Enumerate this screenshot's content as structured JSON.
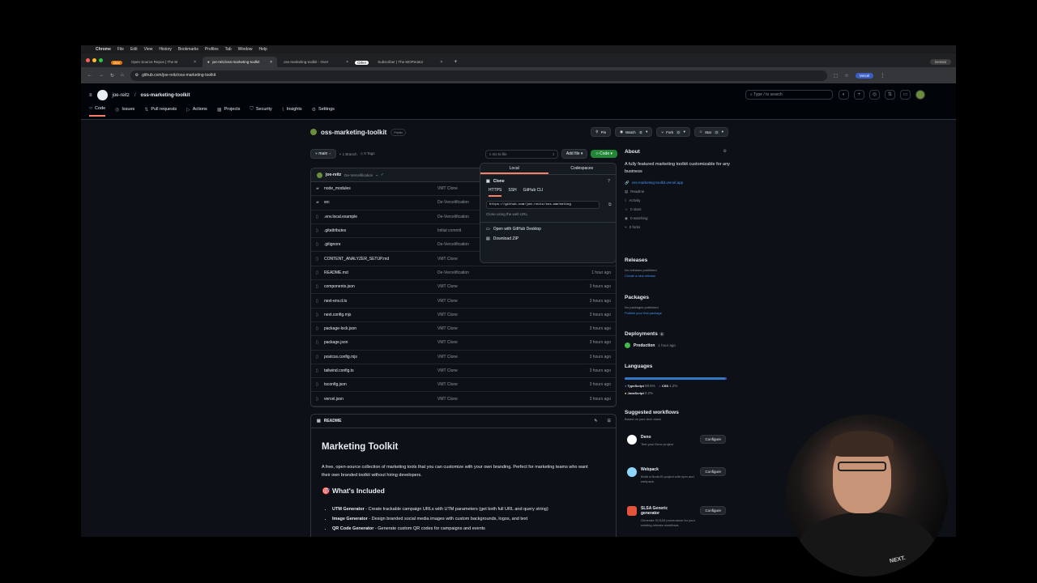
{
  "mac_menu": [
    "Chrome",
    "File",
    "Edit",
    "View",
    "History",
    "Bookmarks",
    "Profiles",
    "Tab",
    "Window",
    "Help"
  ],
  "browser_tabs": [
    {
      "group": "Dev",
      "title": "Open Source Repos | The M",
      "active": false
    },
    {
      "title": "joe-reitz/oss-marketing-toolkit",
      "active": true
    },
    {
      "title": "oss-marketing-toolkit - Over",
      "active": false
    },
    {
      "group": "Other",
      "title": "Subscriber | The MOPerator",
      "active": false
    }
  ],
  "gemini_label": "Gemini",
  "url": "github.com/joe-reitz/oss-marketing-toolkit",
  "profile_label": "Vercel",
  "github": {
    "owner": "joe-reitz",
    "repo": "oss-marketing-toolkit",
    "search_placeholder": "Type / to search",
    "nav": [
      {
        "label": "Code",
        "icon": "code-icon"
      },
      {
        "label": "Issues",
        "icon": "issue-icon"
      },
      {
        "label": "Pull requests",
        "icon": "pull-request-icon"
      },
      {
        "label": "Actions",
        "icon": "play-icon"
      },
      {
        "label": "Projects",
        "icon": "table-icon"
      },
      {
        "label": "Security",
        "icon": "shield-icon"
      },
      {
        "label": "Insights",
        "icon": "graph-icon"
      },
      {
        "label": "Settings",
        "icon": "gear-icon"
      }
    ]
  },
  "repo_header": {
    "name": "oss-marketing-toolkit",
    "visibility": "Public",
    "pin": "Pin",
    "watch": "Watch",
    "watch_count": "0",
    "fork": "Fork",
    "fork_count": "0",
    "star": "Star",
    "star_count": "0"
  },
  "toolbar": {
    "branch": "main",
    "branches": "1 Branch",
    "tags": "0 Tags",
    "goto_placeholder": "Go to file",
    "goto_key": "t",
    "add_file": "Add file",
    "code": "Code"
  },
  "commit": {
    "user": "joe-reitz",
    "message": "De-Vercelification"
  },
  "files": [
    {
      "type": "folder",
      "name": "node_modules",
      "message": "VMT Clone",
      "date": ""
    },
    {
      "type": "folder",
      "name": "src",
      "message": "De-Vercelification",
      "date": ""
    },
    {
      "type": "file",
      "name": ".env.local.example",
      "message": "De-Vercelification",
      "date": ""
    },
    {
      "type": "file",
      "name": ".gitattributes",
      "message": "Initial commit",
      "date": ""
    },
    {
      "type": "file",
      "name": ".gitignore",
      "message": "De-Vercelification",
      "date": ""
    },
    {
      "type": "file",
      "name": "CONTENT_ANALYZER_SETUP.md",
      "message": "VMT Clone",
      "date": ""
    },
    {
      "type": "file",
      "name": "README.md",
      "message": "De-Vercelification",
      "date": "1 hour ago"
    },
    {
      "type": "file",
      "name": "components.json",
      "message": "VMT Clone",
      "date": "3 hours ago"
    },
    {
      "type": "file",
      "name": "next-env.d.ts",
      "message": "VMT Clone",
      "date": "3 hours ago"
    },
    {
      "type": "file",
      "name": "next.config.mjs",
      "message": "VMT Clone",
      "date": "3 hours ago"
    },
    {
      "type": "file",
      "name": "package-lock.json",
      "message": "VMT Clone",
      "date": "3 hours ago"
    },
    {
      "type": "file",
      "name": "package.json",
      "message": "VMT Clone",
      "date": "3 hours ago"
    },
    {
      "type": "file",
      "name": "postcss.config.mjs",
      "message": "VMT Clone",
      "date": "3 hours ago"
    },
    {
      "type": "file",
      "name": "tailwind.config.ts",
      "message": "VMT Clone",
      "date": "3 hours ago"
    },
    {
      "type": "file",
      "name": "tsconfig.json",
      "message": "VMT Clone",
      "date": "3 hours ago"
    },
    {
      "type": "file",
      "name": "vercel.json",
      "message": "VMT Clone",
      "date": "3 hours ago"
    }
  ],
  "clone": {
    "tab_local": "Local",
    "tab_codespaces": "Codespaces",
    "heading": "Clone",
    "subtabs": [
      "HTTPS",
      "SSH",
      "GitHub CLI"
    ],
    "url": "https://github.com/joe-reitz/oss-marketing",
    "hint": "Clone using the web URL.",
    "open_desktop": "Open with GitHub Desktop",
    "download_zip": "Download ZIP"
  },
  "readme": {
    "label": "README",
    "title": "Marketing Toolkit",
    "description": "A free, open-source collection of marketing tools that you can customize with your own branding. Perfect for marketing teams who want their own branded toolkit without hiring developers.",
    "section": "What's Included",
    "section_emoji": "🎯",
    "items": [
      {
        "bold": "UTM Generator",
        "text": " - Create trackable campaign URLs with UTM parameters (get both full URL and query string)"
      },
      {
        "bold": "Image Generator",
        "text": " - Design branded social media images with custom backgrounds, logos, and text"
      },
      {
        "bold": "QR Code Generator",
        "text": " - Generate custom QR codes for campaigns and events"
      }
    ]
  },
  "about": {
    "heading": "About",
    "description": "A fully featured marketing toolkit customizable for any business",
    "link": "oss-marketing-toolkit.vercel.app",
    "stats": [
      "Readme",
      "Activity",
      "0 stars",
      "0 watching",
      "0 forks"
    ]
  },
  "releases": {
    "heading": "Releases",
    "text": "No releases published",
    "link": "Create a new release"
  },
  "packages": {
    "heading": "Packages",
    "text": "No packages published",
    "link": "Publish your first package"
  },
  "deployments": {
    "heading": "Deployments",
    "count": "1",
    "env": "Production",
    "time": "1 hour ago"
  },
  "languages": {
    "heading": "Languages",
    "items": [
      {
        "name": "TypeScript",
        "pct": "98.6%",
        "color": "#3178c6",
        "value": 98.6
      },
      {
        "name": "CSS",
        "pct": "1.2%",
        "color": "#663399",
        "value": 1.2
      },
      {
        "name": "JavaScript",
        "pct": "0.2%",
        "color": "#f1e05a",
        "value": 0.2
      }
    ]
  },
  "workflows": {
    "heading": "Suggested workflows",
    "sub": "Based on your tech stack",
    "configure": "Configure",
    "items": [
      {
        "name": "Deno",
        "desc": "Test your Deno project"
      },
      {
        "name": "Webpack",
        "desc": "Build a NodeJS project with npm and webpack."
      },
      {
        "name": "SLSA Generic generator",
        "desc": "Generate SLSA3 provenance for your existing release workflows"
      }
    ]
  },
  "webcam_logo": "NEXT."
}
